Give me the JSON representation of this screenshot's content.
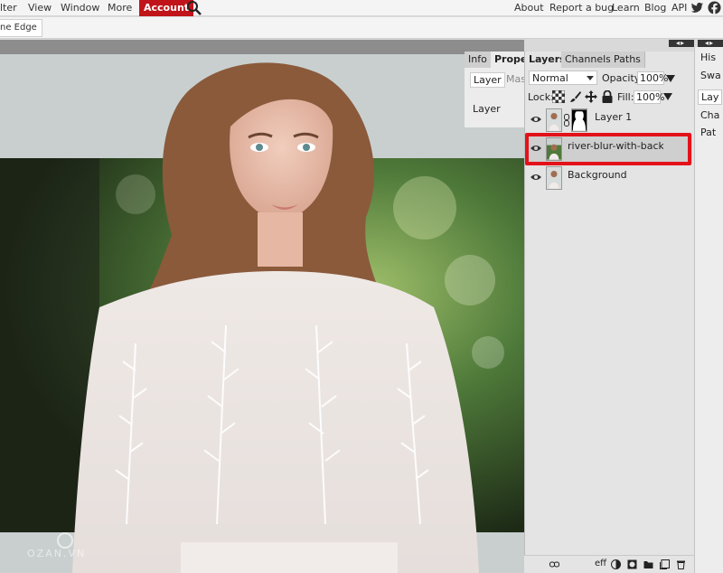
{
  "menubar": {
    "items": [
      "lter",
      "View",
      "Window",
      "More"
    ],
    "account": "Account",
    "links": [
      "About",
      "Report a bug",
      "Learn",
      "Blog",
      "API"
    ]
  },
  "options": {
    "edge_button": "ne Edge"
  },
  "properties": {
    "tabs": [
      "Info",
      "Proper"
    ],
    "subtabs": [
      "Layer",
      "Mas"
    ],
    "row_label": "Layer"
  },
  "layers": {
    "tabs": [
      "Layers",
      "Channels",
      "Paths"
    ],
    "blend_mode": "Normal",
    "opacity_label": "Opacity:",
    "opacity_value": "100%",
    "lock_label": "Lock:",
    "fill_label": "Fill:",
    "fill_value": "100%",
    "items": [
      {
        "name": "Layer 1",
        "visible": true,
        "has_mask": true
      },
      {
        "name": "river-blur-with-backgro",
        "visible": true,
        "selected": true
      },
      {
        "name": "Background",
        "visible": true
      }
    ],
    "bottom_first": "eff"
  },
  "side_panel": {
    "items": [
      "His",
      "Swa",
      "Lay",
      "Cha",
      "Pat"
    ]
  },
  "watermark": "OZAN.VN",
  "colors": {
    "accent": "#c0141a",
    "highlight": "#e3121a",
    "panel": "#e4e4e4"
  }
}
